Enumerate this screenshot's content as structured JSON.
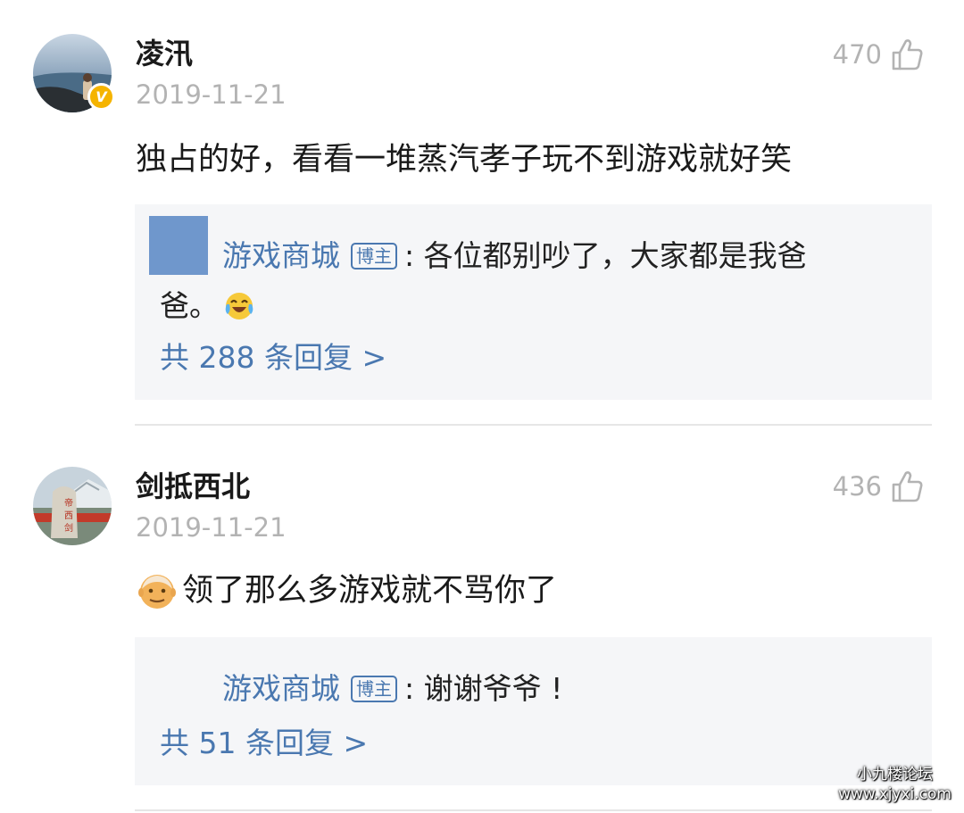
{
  "comments": [
    {
      "username": "凌汛",
      "verified_badge": "V",
      "date": "2019-11-21",
      "likes": "470",
      "text": "独占的好，看看一堆蒸汽孝子玩不到游戏就好笑",
      "reply": {
        "author": "游戏商城",
        "tag": "博主",
        "text_line1": ": 各位都别吵了，大家都是我爸",
        "text_line2": "爸。",
        "emoji": "laughing-crying-emoji",
        "count_label": "共 288 条回复 >"
      }
    },
    {
      "username": "剑抵西北",
      "date": "2019-11-21",
      "likes": "436",
      "emoji": "old-man-emoji",
      "text": "领了那么多游戏就不骂你了",
      "reply": {
        "author": "游戏商城",
        "tag": "博主",
        "text_line1": ": 谢谢爷爷 !",
        "count_label": "共 51 条回复 >"
      }
    }
  ],
  "watermark": {
    "line1": "小九楼论坛",
    "line2": "www.xjyxi.com"
  },
  "colors": {
    "link_blue": "#4a78b0",
    "muted_gray": "#b3b3b3",
    "reply_bg": "#f5f6f8",
    "badge_gold": "#f5b400"
  }
}
